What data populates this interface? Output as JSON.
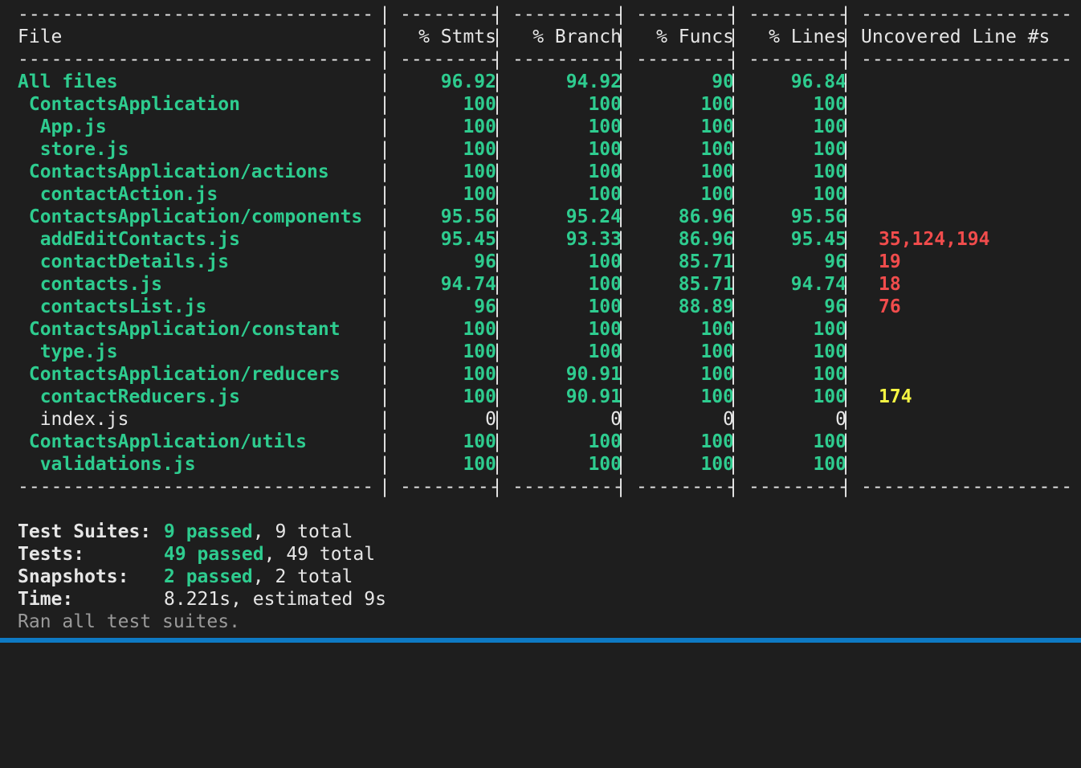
{
  "header": {
    "file": "File",
    "stmts": "% Stmts",
    "branch": "% Branch",
    "funcs": "% Funcs",
    "lines": "% Lines",
    "uncovered": "Uncovered Line #s"
  },
  "separator": {
    "file": "--------------------------------",
    "stmts": "----------",
    "branch": "----------",
    "funcs": "---------",
    "lines": "---------",
    "uncovered": "-------------------"
  },
  "rows": [
    {
      "file": "All files",
      "indent": "",
      "stmts": "96.92",
      "branch": "94.92",
      "funcs": "90",
      "lines": "96.84",
      "uncovered": "",
      "color": "green",
      "uncolor": ""
    },
    {
      "file": "ContactsApplication",
      "indent": " ",
      "stmts": "100",
      "branch": "100",
      "funcs": "100",
      "lines": "100",
      "uncovered": "",
      "color": "green",
      "uncolor": ""
    },
    {
      "file": "App.js",
      "indent": "  ",
      "stmts": "100",
      "branch": "100",
      "funcs": "100",
      "lines": "100",
      "uncovered": "",
      "color": "green",
      "uncolor": ""
    },
    {
      "file": "store.js",
      "indent": "  ",
      "stmts": "100",
      "branch": "100",
      "funcs": "100",
      "lines": "100",
      "uncovered": "",
      "color": "green",
      "uncolor": ""
    },
    {
      "file": "ContactsApplication/actions",
      "indent": " ",
      "stmts": "100",
      "branch": "100",
      "funcs": "100",
      "lines": "100",
      "uncovered": "",
      "color": "green",
      "uncolor": ""
    },
    {
      "file": "contactAction.js",
      "indent": "  ",
      "stmts": "100",
      "branch": "100",
      "funcs": "100",
      "lines": "100",
      "uncovered": "",
      "color": "green",
      "uncolor": ""
    },
    {
      "file": "ContactsApplication/components",
      "indent": " ",
      "stmts": "95.56",
      "branch": "95.24",
      "funcs": "86.96",
      "lines": "95.56",
      "uncovered": "",
      "color": "green",
      "uncolor": ""
    },
    {
      "file": "addEditContacts.js",
      "indent": "  ",
      "stmts": "95.45",
      "branch": "93.33",
      "funcs": "86.96",
      "lines": "95.45",
      "uncovered": "35,124,194",
      "color": "green",
      "uncolor": "red"
    },
    {
      "file": "contactDetails.js",
      "indent": "  ",
      "stmts": "96",
      "branch": "100",
      "funcs": "85.71",
      "lines": "96",
      "uncovered": "19",
      "color": "green",
      "uncolor": "red"
    },
    {
      "file": "contacts.js",
      "indent": "  ",
      "stmts": "94.74",
      "branch": "100",
      "funcs": "85.71",
      "lines": "94.74",
      "uncovered": "18",
      "color": "green",
      "uncolor": "red"
    },
    {
      "file": "contactsList.js",
      "indent": "  ",
      "stmts": "96",
      "branch": "100",
      "funcs": "88.89",
      "lines": "96",
      "uncovered": "76",
      "color": "green",
      "uncolor": "red"
    },
    {
      "file": "ContactsApplication/constant",
      "indent": " ",
      "stmts": "100",
      "branch": "100",
      "funcs": "100",
      "lines": "100",
      "uncovered": "",
      "color": "green",
      "uncolor": ""
    },
    {
      "file": "type.js",
      "indent": "  ",
      "stmts": "100",
      "branch": "100",
      "funcs": "100",
      "lines": "100",
      "uncovered": "",
      "color": "green",
      "uncolor": ""
    },
    {
      "file": "ContactsApplication/reducers",
      "indent": " ",
      "stmts": "100",
      "branch": "90.91",
      "funcs": "100",
      "lines": "100",
      "uncovered": "",
      "color": "green",
      "uncolor": ""
    },
    {
      "file": "contactReducers.js",
      "indent": "  ",
      "stmts": "100",
      "branch": "90.91",
      "funcs": "100",
      "lines": "100",
      "uncovered": "174",
      "color": "green",
      "uncolor": "yellow"
    },
    {
      "file": "index.js",
      "indent": "  ",
      "stmts": "0",
      "branch": "0",
      "funcs": "0",
      "lines": "0",
      "uncovered": "",
      "color": "white",
      "uncolor": ""
    },
    {
      "file": "ContactsApplication/utils",
      "indent": " ",
      "stmts": "100",
      "branch": "100",
      "funcs": "100",
      "lines": "100",
      "uncovered": "",
      "color": "green",
      "uncolor": ""
    },
    {
      "file": "validations.js",
      "indent": "  ",
      "stmts": "100",
      "branch": "100",
      "funcs": "100",
      "lines": "100",
      "uncovered": "",
      "color": "green",
      "uncolor": ""
    }
  ],
  "summary": {
    "suites_label": "Test Suites:",
    "suites_passed": "9 passed",
    "suites_total": ", 9 total",
    "tests_label": "Tests:",
    "tests_passed": "49 passed",
    "tests_total": ", 49 total",
    "snapshots_label": "Snapshots:",
    "snapshots_passed": "2 passed",
    "snapshots_total": ", 2 total",
    "time_label": "Time:",
    "time_value": "8.221s, estimated 9s",
    "footer": "Ran all test suites."
  },
  "colors": {
    "background": "#1e1e1e",
    "green": "#2ecc8f",
    "red": "#f14c4c",
    "yellow": "#f5f543",
    "statusbar": "#0e7ac4"
  }
}
